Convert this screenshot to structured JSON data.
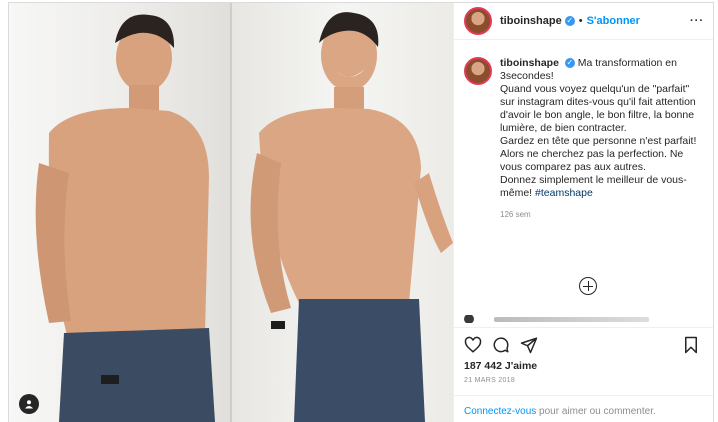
{
  "post": {
    "username": "tiboinshape",
    "follow_label": "S'abonner",
    "separator": "•",
    "more_label": "···",
    "caption": {
      "line1": "Ma transformation en 3secondes!",
      "line2": "Quand vous voyez quelqu'un de \"parfait\" sur instagram dites-vous qu'il fait attention d'avoir le bon angle, le bon filtre, la bonne lumière, de bien contracter.",
      "line3": "Gardez en tête que personne n'est parfait!",
      "line4": "Alors ne cherchez pas la perfection. Ne vous comparez pas aux autres.",
      "line5": "Donnez simplement le meilleur de vous-même!",
      "hashtag": "#teamshape",
      "time": "126 sem"
    },
    "likes": "187 442 J'aime",
    "date": "21 MARS 2018",
    "login": {
      "link": "Connectez-vous",
      "rest": " pour aimer ou commenter."
    }
  },
  "icons": {
    "like": "heart-icon",
    "comment": "comment-icon",
    "share": "share-icon",
    "save": "bookmark-icon",
    "add_comment": "plus-circle-icon",
    "user_tag": "user-icon",
    "verified": "verified-badge-icon"
  },
  "colors": {
    "link": "#0095f6",
    "hashtag": "#00376b",
    "verified": "#3897f0",
    "text": "#262626",
    "muted": "#8e8e8e"
  }
}
